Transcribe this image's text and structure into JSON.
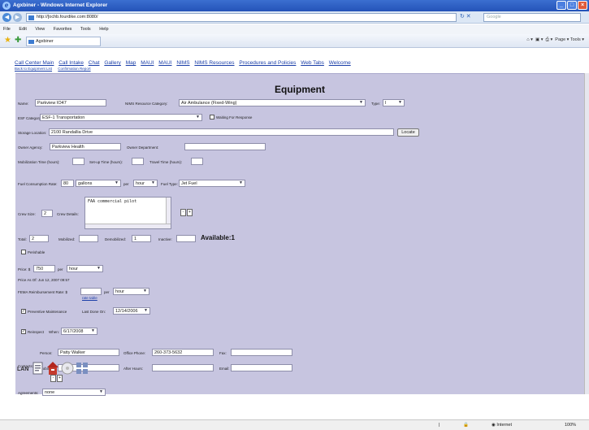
{
  "window": {
    "title": "Agxbiner - Windows Internet Explorer"
  },
  "browser": {
    "url": "http://[ochb.fourdike.com:8080/",
    "search_placeholder": "Google",
    "menu": [
      "File",
      "Edit",
      "View",
      "Favorites",
      "Tools",
      "Help"
    ],
    "tab_title": "Agxbiner",
    "tools": "Page ▾  Tools ▾"
  },
  "nav": {
    "links": [
      "Call Center Main",
      "Call Intake",
      "Chat",
      "Gallery",
      "Map",
      "MAUI",
      "MAUI",
      "NIMS",
      "NIMS Resources",
      "Procedures and Policies",
      "Web Tabs",
      "Welcome"
    ],
    "sublinks": [
      "Back to Equipment List",
      "Confirmation Report"
    ]
  },
  "form": {
    "title": "Equipment",
    "name_label": "Name:",
    "name": "Parkview IO47",
    "nims_cat_label": "NIMS Resource Category:",
    "nims_cat": "Air Ambulance (Fixed-Wing)",
    "type_label": "Type:",
    "type": "I",
    "esf_label": "ESF Category:",
    "esf": "ESF-1 Transportation",
    "waiting_label": "Waiting For Response",
    "storage_label": "Storage Location:",
    "storage": "2100 Randallia Drive",
    "locate": "Locate",
    "owner_agency_label": "Owner Agency:",
    "owner_agency": "Parkview Health",
    "owner_dept_label": "Owner Department:",
    "owner_dept": "",
    "mobil_label": "Mobilization Time (hours):",
    "setup_label": "Set-up Time (hours):",
    "travel_label": "Travel Time (hours):",
    "fuel_rate_label": "Fuel Consumption Rate:",
    "fuel_rate": "80",
    "fuel_unit": "gallons",
    "per_label": "per",
    "per_unit": "hour",
    "fuel_type_label": "Fuel Type:",
    "fuel_type": "Jet Fuel",
    "crew_size_label": "Crew Size:",
    "crew_size": "2",
    "crew_details_label": "Crew Details:",
    "crew_details": "FAA commercial pilot",
    "total_label": "Total:",
    "total": "2",
    "mobilized_label": "Mobilized:",
    "mobilized": "",
    "demobilized_label": "Demobilized:",
    "demobilized": "1",
    "inactive_label": "Inactive:",
    "inactive": "",
    "available": "Available:1",
    "perishable_label": "Perishable",
    "price_label": "Price: $",
    "price": "750",
    "price_per_label": "per",
    "price_unit": "hour",
    "price_asof": "Price As Of: Jun 12, 2007 09:57",
    "fema_label": "FEMA Reimbursement Rate: $",
    "fema": "",
    "fema_per_label": "per",
    "fema_unit": "hour",
    "rate_table": "rate table",
    "prev_maint_label": "Preventive Maintenance",
    "last_done_label": "Last Done On:",
    "last_done": "12/14/2006",
    "reinspect_label": "Reinspect",
    "when_label": "When:",
    "when": "6/17/2008",
    "person_label": "Person:",
    "person": "Patty Walker",
    "office_phone_label": "Office Phone:",
    "office_phone": "260-373-5632",
    "fax_label": "Fax:",
    "contacts_label": "Contacts:",
    "mobile_label": "Mobile:",
    "after_hours_label": "After Hours:",
    "email_label": "Email:",
    "agreements_label": "Agreements:",
    "agreements": "none"
  },
  "footer": {
    "lan": "LAN",
    "zone": "Internet",
    "zoom": "100%"
  }
}
